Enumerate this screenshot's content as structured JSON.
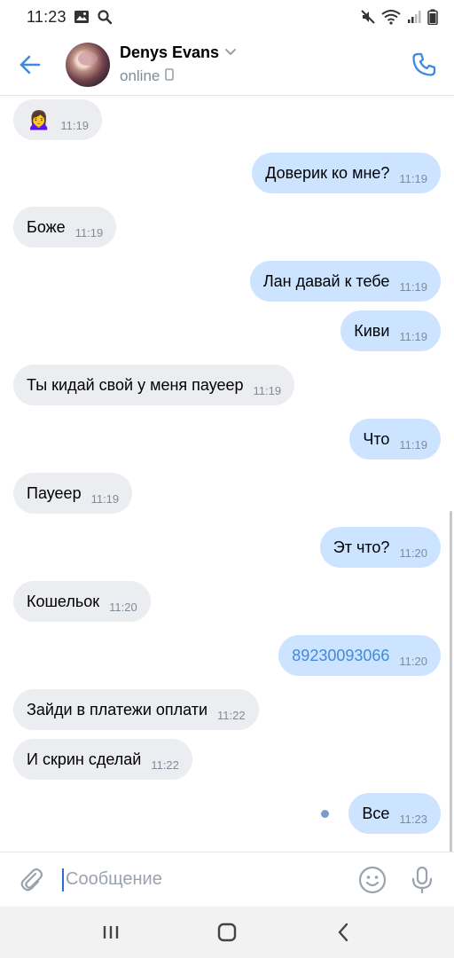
{
  "status_bar": {
    "time": "11:23",
    "left_icons": [
      "image-icon",
      "search-icon"
    ],
    "right_icons": [
      "mute-icon",
      "wifi-icon",
      "signal-icon",
      "battery-icon"
    ]
  },
  "header": {
    "name": "Denys Evans",
    "status": "online",
    "back_icon": "arrow-left-icon",
    "call_icon": "phone-icon",
    "status_device_icon": "phone-device-icon",
    "dropdown_icon": "chevron-down-icon",
    "accent_color": "#3f8ae0"
  },
  "messages": [
    {
      "dir": "in",
      "text": "🙍‍♀️",
      "time": "11:19"
    },
    {
      "dir": "out",
      "text": "Доверик ко мне?",
      "time": "11:19"
    },
    {
      "dir": "in",
      "text": "Боже",
      "time": "11:19"
    },
    {
      "dir": "out",
      "text": "Лан давай к тебе",
      "time": "11:19"
    },
    {
      "dir": "out",
      "text": "Киви",
      "time": "11:19"
    },
    {
      "dir": "in",
      "text": "Ты кидай свой у меня пауеер",
      "time": "11:19"
    },
    {
      "dir": "out",
      "text": "Что",
      "time": "11:19"
    },
    {
      "dir": "in",
      "text": "Пауеер",
      "time": "11:19"
    },
    {
      "dir": "out",
      "text": "Эт что?",
      "time": "11:20"
    },
    {
      "dir": "in",
      "text": "Кошельок",
      "time": "11:20"
    },
    {
      "dir": "out",
      "text": "89230093066",
      "time": "11:20",
      "link": true
    },
    {
      "dir": "in",
      "text": "Зайди в платежи оплати",
      "time": "11:22"
    },
    {
      "dir": "in",
      "text": "И скрин сделай",
      "time": "11:22"
    },
    {
      "dir": "out",
      "text": "Все",
      "time": "11:23",
      "unread": true
    }
  ],
  "composer": {
    "placeholder": "Сообщение",
    "attach_icon": "paperclip-icon",
    "emoji_icon": "smiley-icon",
    "mic_icon": "microphone-icon"
  },
  "navbar": {
    "icons": [
      "recent-apps-icon",
      "home-icon",
      "back-icon"
    ]
  },
  "colors": {
    "incoming_bubble": "#ebedf0",
    "outgoing_bubble": "#cce4ff",
    "time_text": "#818c99",
    "link": "#3f8ae0"
  }
}
